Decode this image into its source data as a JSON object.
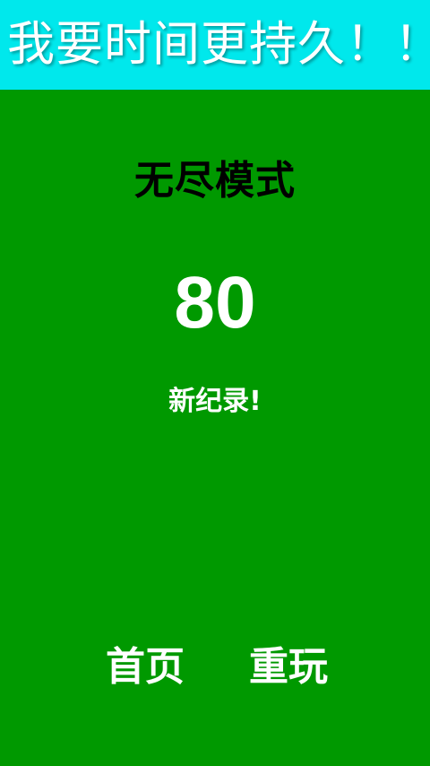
{
  "header": {
    "title": "我要时间更持久！！"
  },
  "result": {
    "mode_title": "无尽模式",
    "score": "80",
    "record_text": "新纪录!"
  },
  "actions": {
    "home_label": "首页",
    "replay_label": "重玩"
  },
  "colors": {
    "background": "#009900",
    "header_background": "#00E8EC",
    "mode_title_text": "#000000",
    "primary_text": "#FFFFFF"
  }
}
